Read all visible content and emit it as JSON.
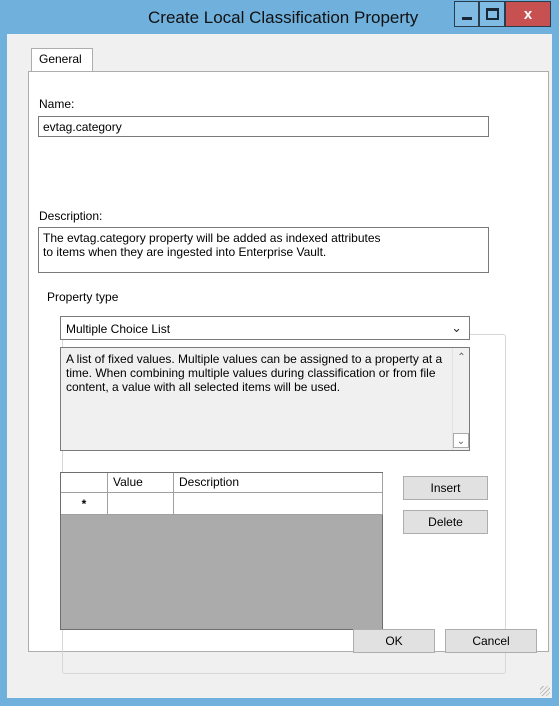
{
  "window": {
    "title": "Create Local Classification Property",
    "close_glyph": "x"
  },
  "tabs": [
    {
      "label": "General"
    }
  ],
  "form": {
    "name_label": "Name:",
    "name_value": "evtag.category",
    "description_label": "Description:",
    "description_value": "The evtag.category property will be added as indexed attributes\nto items when they are ingested into Enterprise Vault.",
    "property_type": {
      "legend": "Property type",
      "selected": "Multiple Choice List",
      "type_description": "A list of fixed values. Multiple values can be assigned to a property at a time. When combining multiple values during classification or from file content, a value with all selected items will be used."
    }
  },
  "grid": {
    "columns": [
      "",
      "Value",
      "Description"
    ],
    "new_row_marker": "*"
  },
  "buttons": {
    "insert": "Insert",
    "delete": "Delete",
    "ok": "OK",
    "cancel": "Cancel"
  },
  "icons": {
    "minimize": "minimize-icon",
    "maximize": "maximize-icon",
    "close": "close-icon",
    "dropdown": "chevron-down-icon",
    "scroll_up": "scroll-up-icon",
    "scroll_down": "scroll-down-icon"
  },
  "colors": {
    "window_frame": "#6fb0dc",
    "close_button": "#c75050",
    "dialog_background": "#f0f0f0"
  }
}
